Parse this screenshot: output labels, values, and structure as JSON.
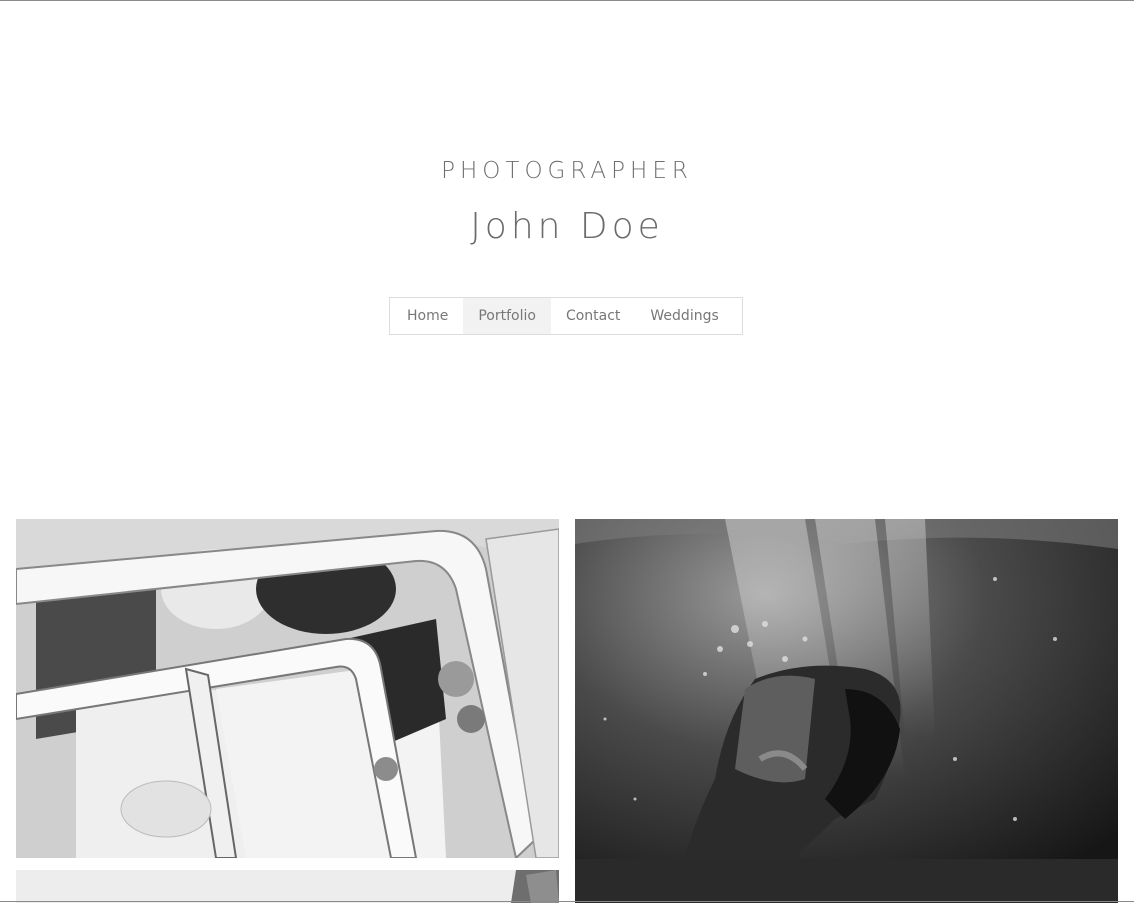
{
  "header": {
    "kicker": "PHOTOGRAPHER",
    "name": "John Doe"
  },
  "nav": {
    "items": [
      {
        "label": "Home",
        "active": false
      },
      {
        "label": "Portfolio",
        "active": true
      },
      {
        "label": "Contact",
        "active": false
      },
      {
        "label": "Weddings",
        "active": false
      }
    ]
  },
  "gallery": {
    "photos": [
      {
        "subject": "bride-in-car-window"
      },
      {
        "subject": "person-underwater"
      },
      {
        "subject": "partial-photo"
      }
    ]
  },
  "colors": {
    "text": "#777777",
    "active_nav_bg": "#f2f2f2",
    "border": "#dcdcdc"
  }
}
